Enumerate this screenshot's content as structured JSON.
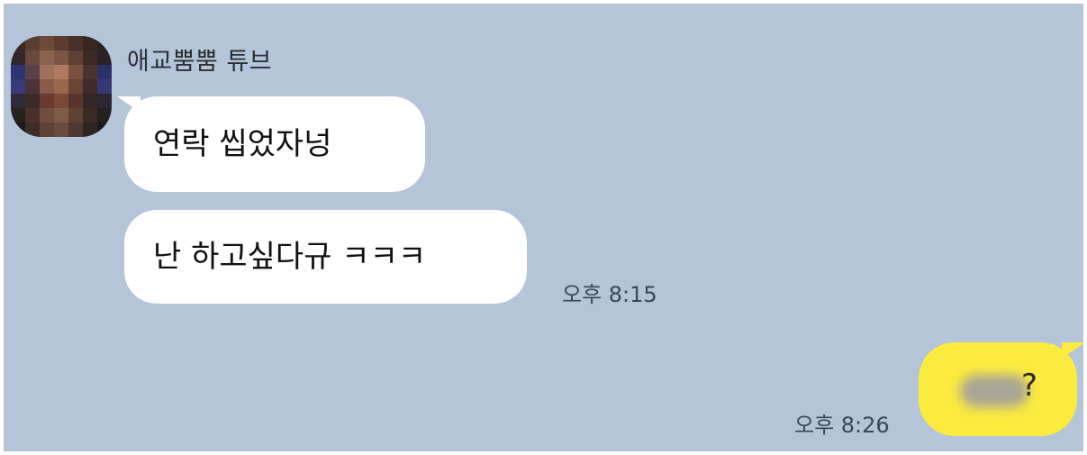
{
  "sender": {
    "name": "애교뿜뿜 튜브"
  },
  "messages_in": [
    {
      "text": "연락 씹었자넝"
    },
    {
      "text": "난 하고싶다규 ㅋㅋㅋ"
    }
  ],
  "time_in": "오후 8:15",
  "message_out": {
    "text": "?"
  },
  "time_out": "오후 8:26",
  "colors": {
    "background": "#b4c5da",
    "incoming_bubble": "#ffffff",
    "outgoing_bubble": "#fbeb3f"
  }
}
